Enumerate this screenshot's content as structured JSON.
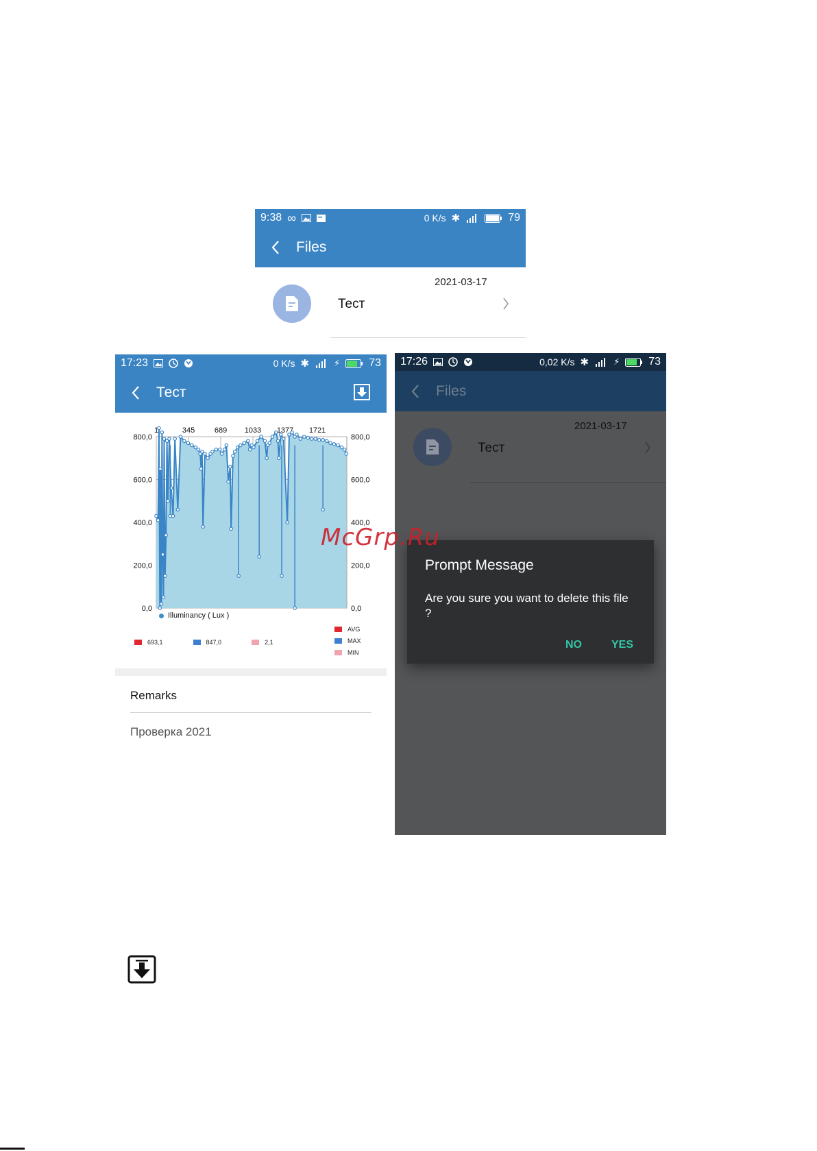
{
  "screen1": {
    "status": {
      "time": "9:38",
      "speed": "0 K/s",
      "battery": "79"
    },
    "toolbar": {
      "title": "Files"
    },
    "file": {
      "date": "2021-03-17",
      "name": "Тест"
    }
  },
  "screen2": {
    "status": {
      "time": "17:23",
      "speed": "0 K/s",
      "battery": "73"
    },
    "toolbar": {
      "title": "Тест"
    },
    "legend_series": "Illuminancy ( Lux )",
    "stats": [
      {
        "value": "693,1",
        "color": "#e0262e"
      },
      {
        "value": "847,0",
        "color": "#3d7fd0"
      },
      {
        "value": "2,1",
        "color": "#f2a3b0"
      }
    ],
    "stats_legend": [
      {
        "label": "AVG",
        "color": "#e0262e"
      },
      {
        "label": "MAX",
        "color": "#3d7fd0"
      },
      {
        "label": "MIN",
        "color": "#f2a3b0"
      }
    ],
    "remarks": {
      "heading": "Remarks",
      "text": "Проверка 2021"
    }
  },
  "screen3": {
    "status": {
      "time": "17:26",
      "speed": "0,02 K/s",
      "battery": "73"
    },
    "toolbar": {
      "title": "Files"
    },
    "file": {
      "date": "2021-03-17",
      "name": "Тест"
    },
    "dialog": {
      "title": "Prompt Message",
      "message": "Are you sure you want to delete this file ?",
      "no": "NO",
      "yes": "YES"
    }
  },
  "watermark": "McGrp.Ru",
  "chart_data": {
    "type": "area",
    "series_name": "Illuminancy ( Lux )",
    "x_ticks": [
      "1",
      "345",
      "689",
      "1033",
      "1377",
      "1721"
    ],
    "x_tick_values": [
      1,
      345,
      689,
      1033,
      1377,
      1721
    ],
    "xlim": [
      1,
      2035
    ],
    "y_ticks": [
      "0,0",
      "200,0",
      "400,0",
      "600,0",
      "800,0"
    ],
    "y_tick_values": [
      0,
      200,
      400,
      600,
      800
    ],
    "ylim": [
      0,
      800
    ],
    "grid": true,
    "x": [
      1,
      20,
      30,
      40,
      45,
      55,
      62,
      70,
      78,
      85,
      95,
      105,
      115,
      125,
      140,
      160,
      180,
      200,
      230,
      260,
      300,
      340,
      380,
      420,
      450,
      470,
      480,
      490,
      500,
      520,
      550,
      580,
      600,
      640,
      680,
      700,
      730,
      750,
      770,
      790,
      800,
      820,
      840,
      870,
      900,
      940,
      980,
      1000,
      1020,
      1040,
      1080,
      1120,
      1160,
      1180,
      1190,
      1210,
      1240,
      1280,
      1300,
      1310,
      1330,
      1360,
      1400,
      1420,
      1450,
      1480,
      1500,
      1540,
      1580,
      1620,
      1660,
      1700,
      1740,
      1780,
      1820,
      1860,
      1900,
      1940,
      1980,
      2010,
      2030
    ],
    "y": [
      430,
      410,
      840,
      0,
      650,
      20,
      820,
      250,
      50,
      790,
      150,
      340,
      780,
      500,
      790,
      560,
      430,
      790,
      460,
      800,
      780,
      770,
      760,
      750,
      740,
      720,
      650,
      730,
      380,
      720,
      700,
      720,
      730,
      740,
      740,
      720,
      740,
      760,
      590,
      660,
      370,
      710,
      730,
      750,
      760,
      770,
      780,
      740,
      760,
      750,
      780,
      800,
      780,
      700,
      760,
      770,
      800,
      820,
      780,
      700,
      810,
      790,
      400,
      810,
      820,
      800,
      810,
      790,
      800,
      795,
      790,
      790,
      785,
      785,
      780,
      770,
      765,
      760,
      750,
      740,
      720
    ],
    "dips": [
      [
        150,
        430
      ],
      [
        880,
        150
      ],
      [
        1100,
        240
      ],
      [
        1340,
        150
      ],
      [
        1480,
        0
      ],
      [
        1780,
        460
      ]
    ]
  }
}
